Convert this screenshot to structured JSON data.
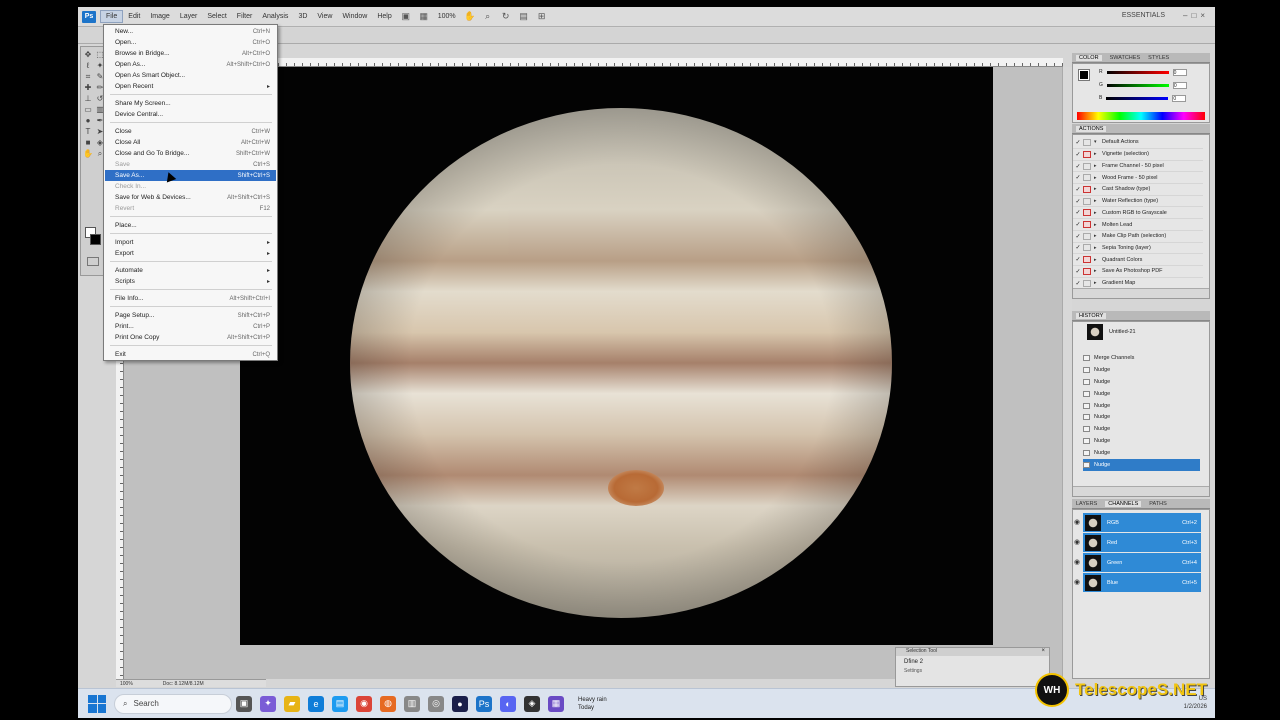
{
  "app": {
    "logo": "Ps",
    "menus": [
      "File",
      "Edit",
      "Image",
      "Layer",
      "Select",
      "Filter",
      "Analysis",
      "3D",
      "View",
      "Window",
      "Help"
    ],
    "zoom": "100%",
    "workspace": "ESSENTIALS",
    "status_zoom": "100%",
    "status_doc": "Doc: 8.12M/8.12M"
  },
  "file_menu": {
    "items": [
      {
        "label": "New...",
        "shortcut": "Ctrl+N"
      },
      {
        "label": "Open...",
        "shortcut": "Ctrl+O"
      },
      {
        "label": "Browse in Bridge...",
        "shortcut": "Alt+Ctrl+O"
      },
      {
        "label": "Open As...",
        "shortcut": "Alt+Shift+Ctrl+O"
      },
      {
        "label": "Open As Smart Object...",
        "shortcut": ""
      },
      {
        "label": "Open Recent",
        "shortcut": ""
      },
      {
        "label": "Share My Screen...",
        "shortcut": ""
      },
      {
        "label": "Device Central...",
        "shortcut": ""
      },
      {
        "label": "Close",
        "shortcut": "Ctrl+W"
      },
      {
        "label": "Close All",
        "shortcut": "Alt+Ctrl+W"
      },
      {
        "label": "Close and Go To Bridge...",
        "shortcut": "Shift+Ctrl+W"
      },
      {
        "label": "Save",
        "shortcut": "Ctrl+S"
      },
      {
        "label": "Save As...",
        "shortcut": "Shift+Ctrl+S"
      },
      {
        "label": "Check In...",
        "shortcut": ""
      },
      {
        "label": "Save for Web & Devices...",
        "shortcut": "Alt+Shift+Ctrl+S"
      },
      {
        "label": "Revert",
        "shortcut": "F12"
      },
      {
        "label": "Place...",
        "shortcut": ""
      },
      {
        "label": "Import",
        "shortcut": ""
      },
      {
        "label": "Export",
        "shortcut": ""
      },
      {
        "label": "Automate",
        "shortcut": ""
      },
      {
        "label": "Scripts",
        "shortcut": ""
      },
      {
        "label": "File Info...",
        "shortcut": "Alt+Shift+Ctrl+I"
      },
      {
        "label": "Page Setup...",
        "shortcut": "Shift+Ctrl+P"
      },
      {
        "label": "Print...",
        "shortcut": "Ctrl+P"
      },
      {
        "label": "Print One Copy",
        "shortcut": "Alt+Shift+Ctrl+P"
      },
      {
        "label": "Exit",
        "shortcut": "Ctrl+Q"
      }
    ]
  },
  "panels": {
    "color_tabs": [
      "COLOR",
      "SWATCHES",
      "STYLES"
    ],
    "rgb_labels": [
      "R",
      "G",
      "B"
    ],
    "rgb_values": [
      "0",
      "0",
      "0"
    ],
    "actions_tab": "ACTIONS",
    "actions_set": "Default Actions",
    "actions": [
      "Vignette (selection)",
      "Frame Channel - 50 pixel",
      "Wood Frame - 50 pixel",
      "Cast Shadow (type)",
      "Water Reflection (type)",
      "Custom RGB to Grayscale",
      "Molten Lead",
      "Make Clip Path (selection)",
      "Sepia Toning (layer)",
      "Quadrant Colors",
      "Save As Photoshop PDF",
      "Gradient Map"
    ],
    "history_tab": "HISTORY",
    "history_snapshot": "Untitled-21",
    "history": [
      "Merge Channels",
      "Nudge",
      "Nudge",
      "Nudge",
      "Nudge",
      "Nudge",
      "Nudge",
      "Nudge",
      "Nudge",
      "Nudge"
    ],
    "layers_tabs": [
      "LAYERS",
      "CHANNELS",
      "PATHS"
    ],
    "channels": [
      {
        "name": "RGB",
        "shortcut": "Ctrl+2"
      },
      {
        "name": "Red",
        "shortcut": "Ctrl+3"
      },
      {
        "name": "Green",
        "shortcut": "Ctrl+4"
      },
      {
        "name": "Blue",
        "shortcut": "Ctrl+5"
      }
    ]
  },
  "refine": {
    "title": "Selection Tool",
    "label": "Dfine 2",
    "settings": "Settings"
  },
  "taskbar": {
    "search_placeholder": "Search",
    "weather_title": "Heavy rain",
    "weather_sub": "Today",
    "tray_locale": "US",
    "tray_date": "1/2/2026"
  },
  "watermark": {
    "logo": "WH",
    "text": "TelescopeS.NET"
  }
}
